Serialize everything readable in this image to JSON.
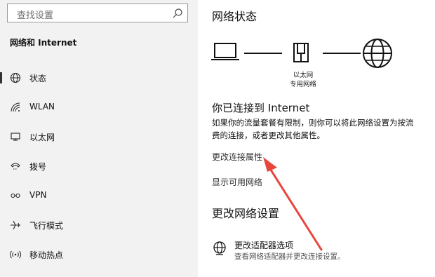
{
  "search": {
    "placeholder": "查找设置",
    "icon": "search-icon"
  },
  "sidebar": {
    "title": "网络和 Internet",
    "items": [
      {
        "label": "状态",
        "icon": "status-globe-icon",
        "selected": true
      },
      {
        "label": "WLAN",
        "icon": "wifi-icon"
      },
      {
        "label": "以太网",
        "icon": "ethernet-icon"
      },
      {
        "label": "拨号",
        "icon": "dialup-icon"
      },
      {
        "label": "VPN",
        "icon": "vpn-icon"
      },
      {
        "label": "飞行模式",
        "icon": "airplane-icon"
      },
      {
        "label": "移动热点",
        "icon": "hotspot-icon"
      }
    ]
  },
  "main": {
    "title": "网络状态",
    "diagram": {
      "caption_line1": "以太网",
      "caption_line2": "专用网络"
    },
    "connected": "你已连接到 Internet",
    "desc_line1": "如果你的流量套餐有限制，则你可以将此网络设置为按流",
    "desc_line2": "费的连接，或者更改其他属性。",
    "link_change_props": "更改连接属性",
    "link_show_networks": "显示可用网络",
    "change_section": "更改网络设置",
    "adapter": {
      "title": "更改适配器选项",
      "subtitle": "查看网络适配器并更改连接设置。"
    }
  },
  "colors": {
    "sidebar_bg": "#f2f2f2",
    "annotation_arrow": "#e8463d"
  }
}
